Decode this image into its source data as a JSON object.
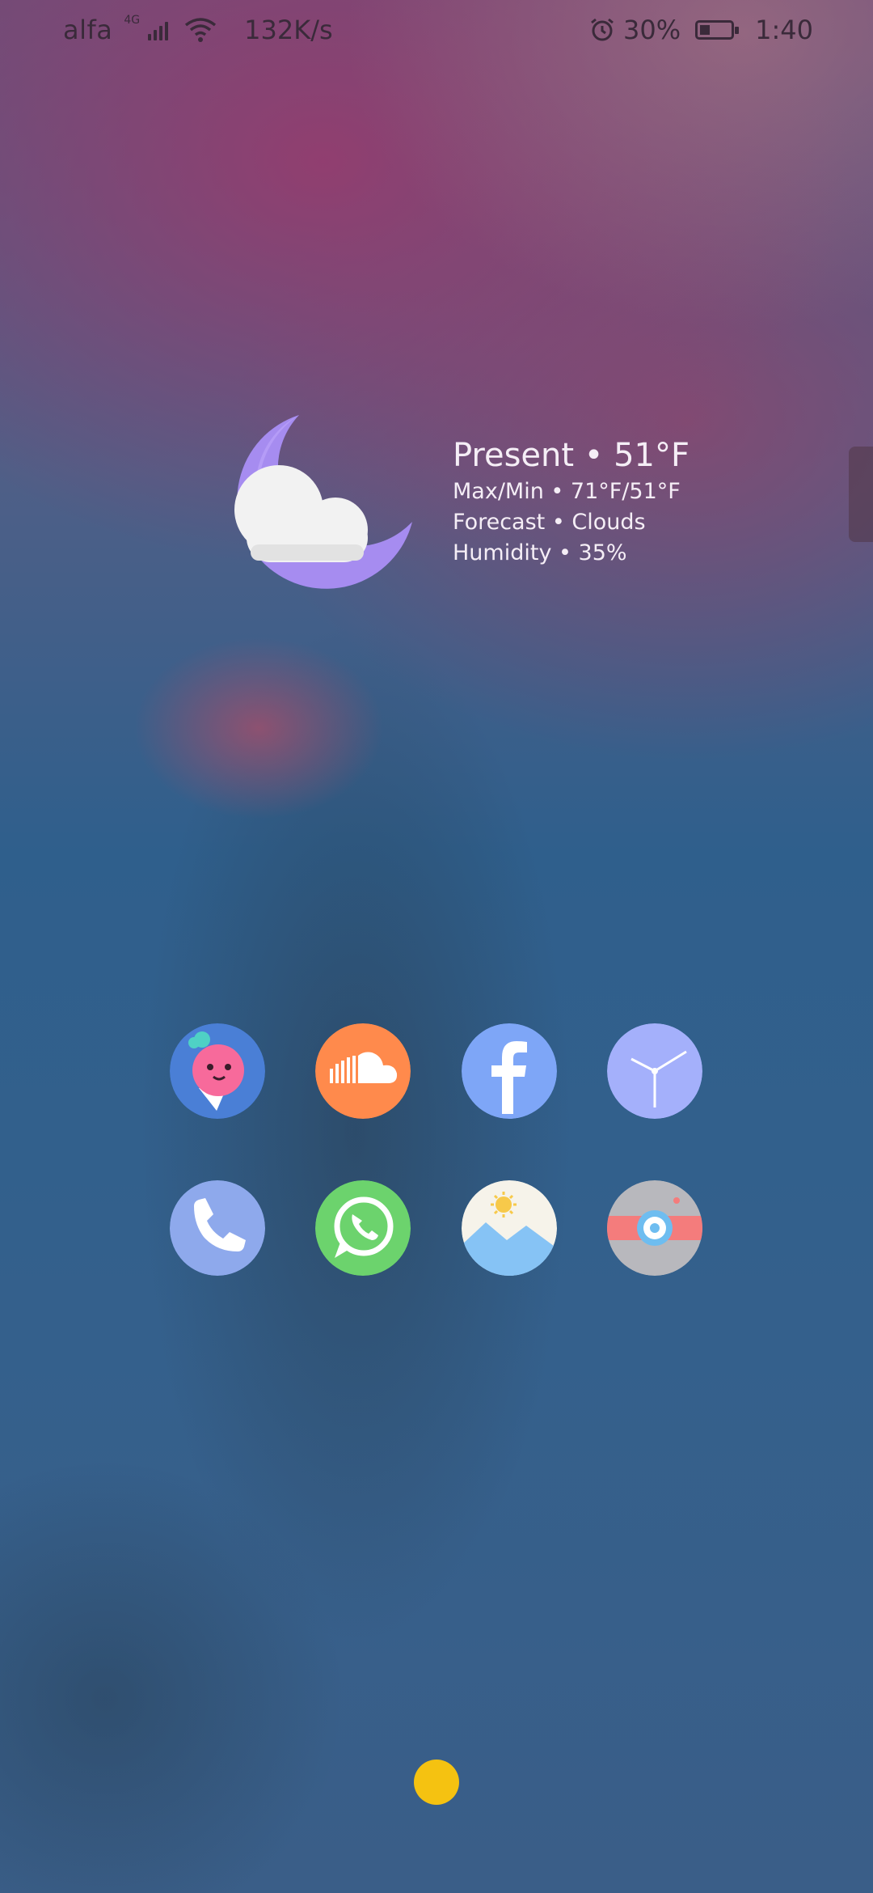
{
  "status_bar": {
    "carrier": "alfa",
    "network_type": "4G",
    "net_speed": "132K/s",
    "battery_percent": "30%",
    "time": "1:40",
    "icons": [
      "signal-icon",
      "wifi-icon",
      "alarm-icon",
      "battery-icon"
    ]
  },
  "weather": {
    "present": "Present • 51°F",
    "max_min": "Max/Min • 71°F/51°F",
    "forecast": "Forecast • Clouds",
    "humidity": "Humidity • 35%",
    "icon": "night-cloudy-icon"
  },
  "apps": [
    {
      "name": "dove-app-icon",
      "color": "#4a7fd6"
    },
    {
      "name": "soundcloud-app-icon",
      "color": "#ff8a4c"
    },
    {
      "name": "facebook-app-icon",
      "color": "#7ea6f7"
    },
    {
      "name": "clock-app-icon",
      "color": "#a4b0fb"
    },
    {
      "name": "phone-app-icon",
      "color": "#8ea9ec"
    },
    {
      "name": "whatsapp-app-icon",
      "color": "#6cd36d"
    },
    {
      "name": "gallery-app-icon",
      "color": "#f6f3ea"
    },
    {
      "name": "camera-app-icon",
      "color": "#b8b8bd"
    }
  ],
  "colors": {
    "page_dot": "#f5c211",
    "status_text": "#3a2a3a"
  }
}
